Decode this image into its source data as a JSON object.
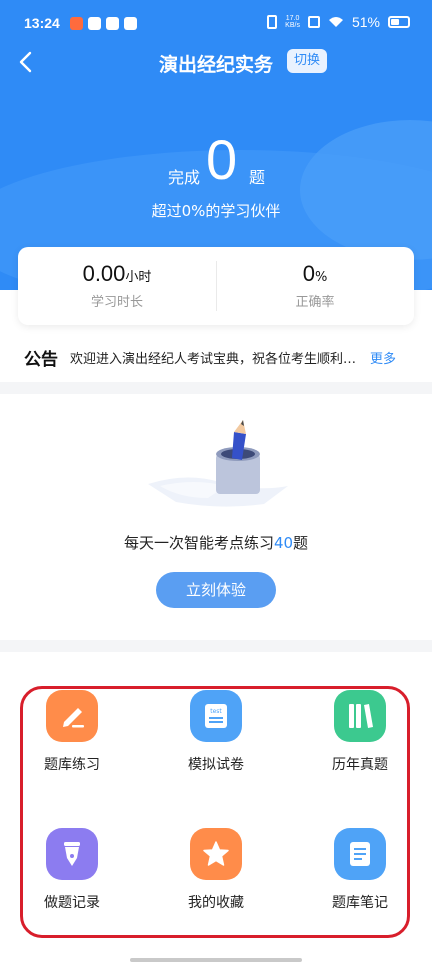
{
  "status_bar": {
    "time": "13:24",
    "speed_top": "17.0",
    "speed_unit": "KB/s",
    "battery": "51%"
  },
  "nav": {
    "title": "演出经纪实务",
    "switch_label": "切换"
  },
  "summary": {
    "done_prefix": "完成",
    "done_count": "0",
    "done_suffix": "题",
    "beyond_text": "超过0%的学习伙伴"
  },
  "stats": {
    "study_time_value": "0.00",
    "study_time_unit": "小时",
    "study_time_label": "学习时长",
    "accuracy_value": "0",
    "accuracy_unit": "%",
    "accuracy_label": "正确率"
  },
  "notice": {
    "tag": "公告",
    "text": "欢迎进入演出经纪人考试宝典，祝各位考生顺利通过考试！",
    "more": "更多"
  },
  "daily": {
    "text_prefix": "每天一次智能考点练习",
    "count": "40",
    "text_suffix": "题",
    "button": "立刻体验"
  },
  "features": [
    {
      "label": "题库练习",
      "icon": "pencil-edit-icon",
      "color": "#ff8c4a"
    },
    {
      "label": "模拟试卷",
      "icon": "test-paper-icon",
      "color": "#4fa3f7"
    },
    {
      "label": "历年真题",
      "icon": "books-icon",
      "color": "#3cc98f"
    },
    {
      "label": "做题记录",
      "icon": "fountain-pen-icon",
      "color": "#8c7cf0"
    },
    {
      "label": "我的收藏",
      "icon": "star-icon",
      "color": "#ff8c4a"
    },
    {
      "label": "题库笔记",
      "icon": "note-icon",
      "color": "#4fa3f7"
    }
  ],
  "feature_icon_text": "test",
  "colors": {
    "primary": "#2f8bf6",
    "highlight_frame": "#d81e2b"
  }
}
